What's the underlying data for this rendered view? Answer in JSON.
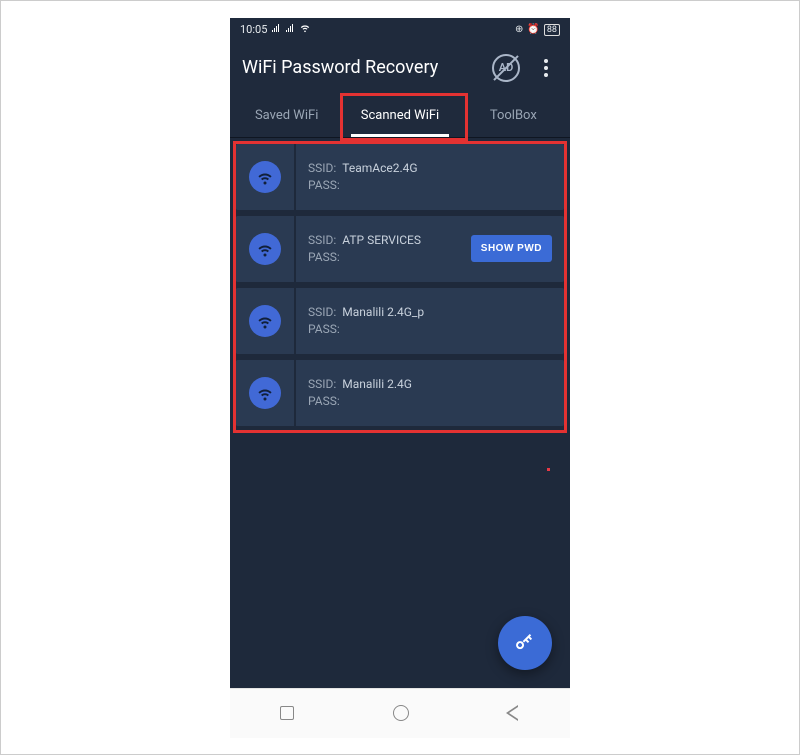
{
  "statusbar": {
    "time": "10:05",
    "battery": "88"
  },
  "appbar": {
    "title": "WiFi Password Recovery",
    "ad_label": "AD"
  },
  "tabs": [
    {
      "label": "Saved WiFi",
      "active": false
    },
    {
      "label": "Scanned WiFi",
      "active": true
    },
    {
      "label": "ToolBox",
      "active": false
    }
  ],
  "field_labels": {
    "ssid": "SSID:",
    "pass": "PASS:"
  },
  "buttons": {
    "show_pwd": "SHOW PWD"
  },
  "networks": [
    {
      "ssid": "TeamAce2.4G",
      "pass": "",
      "show_btn": false
    },
    {
      "ssid": "ATP SERVICES",
      "pass": "",
      "show_btn": true
    },
    {
      "ssid": "Manalili 2.4G_p",
      "pass": "",
      "show_btn": false
    },
    {
      "ssid": "Manalili 2.4G",
      "pass": "",
      "show_btn": false
    }
  ],
  "colors": {
    "accent": "#3b6bd6",
    "surface": "#2a3a52",
    "bg": "#1e293b"
  }
}
